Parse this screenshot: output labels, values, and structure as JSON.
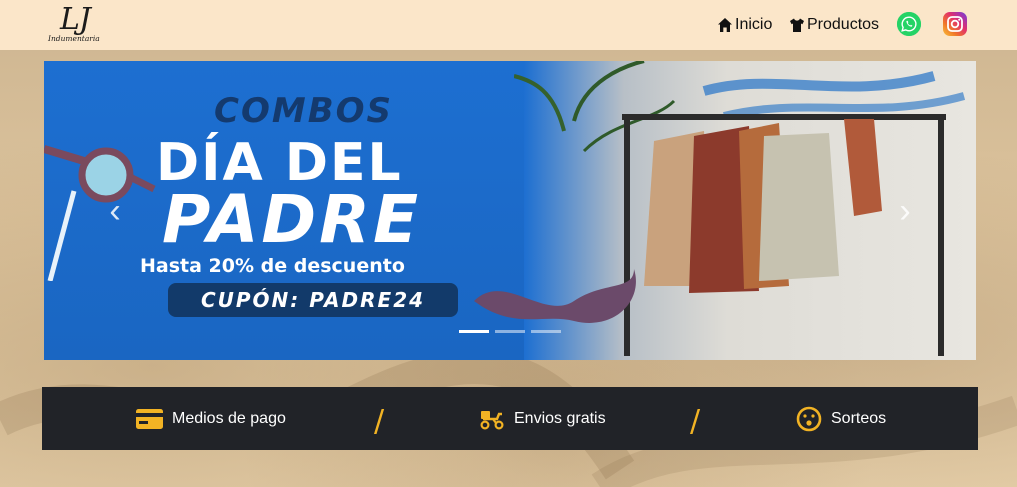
{
  "header": {
    "logo_mark": "LJ",
    "logo_sub": "Indumentaria",
    "nav": [
      {
        "label": "Inicio",
        "icon": "home-icon"
      },
      {
        "label": "Productos",
        "icon": "tshirt-icon"
      }
    ],
    "social": [
      {
        "name": "whatsapp-icon"
      },
      {
        "name": "instagram-icon"
      }
    ]
  },
  "carousel": {
    "slide": {
      "kicker": "COMBOS",
      "title_line1": "DÍA DEL",
      "title_line2": "PADRE",
      "subtitle": "Hasta 20% de descuento",
      "coupon": "CUPÓN: PADRE24"
    },
    "prev_label": "‹",
    "next_label": "›",
    "indicator_count": 3,
    "active_index": 0
  },
  "infobar": {
    "items": [
      {
        "label": "Medios de pago",
        "icon": "credit-card-icon"
      },
      {
        "label": "Envios gratis",
        "icon": "delivery-scooter-icon"
      },
      {
        "label": "Sorteos",
        "icon": "surprised-face-icon"
      }
    ],
    "separator": "/"
  },
  "colors": {
    "navbar_bg": "#fbe6c9",
    "infobar_bg": "#212328",
    "accent": "#f2b324",
    "banner_blue": "#1d6fd1"
  }
}
